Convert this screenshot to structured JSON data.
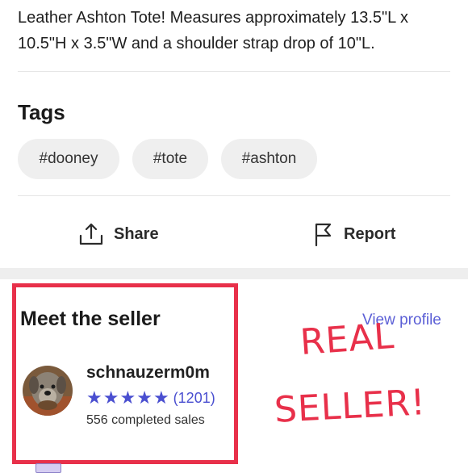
{
  "listing": {
    "description": "Leather Ashton Tote!  Measures approximately 13.5\"L x 10.5\"H x 3.5\"W and a shoulder strap drop of 10\"L."
  },
  "tags": {
    "title": "Tags",
    "items": [
      "#dooney",
      "#tote",
      "#ashton"
    ]
  },
  "actions": {
    "share_label": "Share",
    "report_label": "Report"
  },
  "seller": {
    "section_title": "Meet the seller",
    "view_profile_label": "View profile",
    "username": "schnauzerm0m",
    "rating_stars": 5,
    "rating_count": "(1201)",
    "completed_sales": "556 completed sales"
  },
  "annotation": {
    "line1": "REAL",
    "line2": "SELLER!",
    "color": "#e8304a"
  },
  "theme": {
    "accent": "#4a4fd0",
    "tag_bg": "#efefef"
  }
}
